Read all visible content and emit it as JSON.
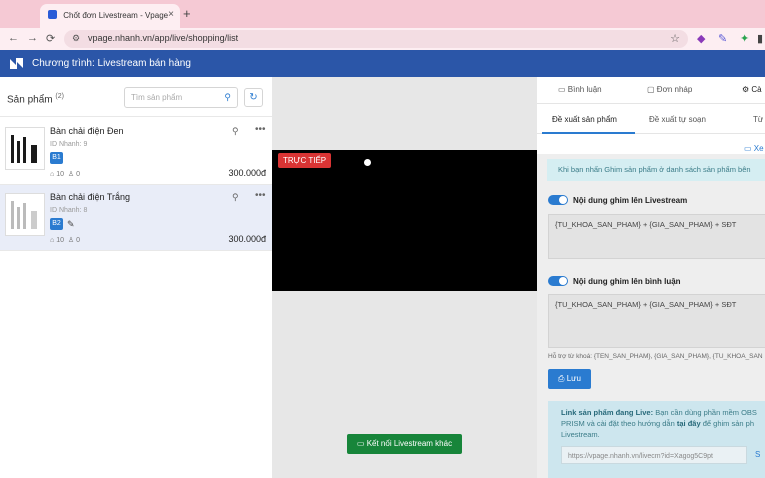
{
  "browser": {
    "tab_title": "Chốt đơn Livestream - Vpage",
    "tab_close": "×",
    "new_tab": "+",
    "url": "vpage.nhanh.vn/app/live/shopping/list",
    "back": "←",
    "forward": "→",
    "reload": "⟳",
    "star": "☆"
  },
  "app": {
    "title": "Chương trình: Livestream bán hàng"
  },
  "products_panel": {
    "label": "Sản phẩm",
    "count": "(2)",
    "search_placeholder": "Tìm sản phẩm",
    "items": [
      {
        "name": "Bàn chải điện Đen",
        "id_text": "ID Nhanh: 9",
        "badge": "B1",
        "likes": "10",
        "comments": "0",
        "price": "300.000đ"
      },
      {
        "name": "Bàn chải điện Trắng",
        "id_text": "ID Nhanh: 8",
        "badge": "B2",
        "likes": "10",
        "comments": "0",
        "price": "300.000đ"
      }
    ]
  },
  "video": {
    "live_label": "TRỰC TIẾP",
    "connect_button": "Kết nối Livestream khác"
  },
  "right_panel": {
    "tabs": [
      "Bình luận",
      "Đơn nháp",
      "Cà"
    ],
    "subtabs": [
      "Đề xuất sản phẩm",
      "Đề xuất tự soạn",
      "Từ"
    ],
    "view_link": "Xe",
    "info_text": "Khi bạn nhấn Ghim sản phẩm ở danh sách sản phẩm bên",
    "pin_live_label": "Nội dung ghim lên Livestream",
    "pin_live_value": "{TU_KHOA_SAN_PHAM} + {GIA_SAN_PHAM} + SĐT",
    "pin_comment_label": "Nội dung ghim lên bình luận",
    "pin_comment_value": "{TU_KHOA_SAN_PHAM} + {GIA_SAN_PHAM} + SĐT",
    "hint": "Hỗ trợ từ khoá: {TEN_SAN_PHAM}, {GIA_SAN_PHAM}, {TU_KHOA_SAN",
    "save_button": "Lưu",
    "link_title": "Link sản phẩm đang Live:",
    "link_desc_1": "Bạn cần dùng phần mềm OBS",
    "link_desc_2": "PRISM và cài đặt theo hướng dẫn",
    "link_here": "tại đây",
    "link_desc_3": "để ghim sản ph",
    "link_desc_4": "Livestream.",
    "link_value": "https://vpage.nhanh.vn/livecm?id=Xagog5C9pt",
    "link_button": "S"
  },
  "colors": {
    "header_blue": "#2b56a8",
    "accent_blue": "#2a7bd0",
    "live_red": "#d93434",
    "connect_green": "#17853a"
  }
}
